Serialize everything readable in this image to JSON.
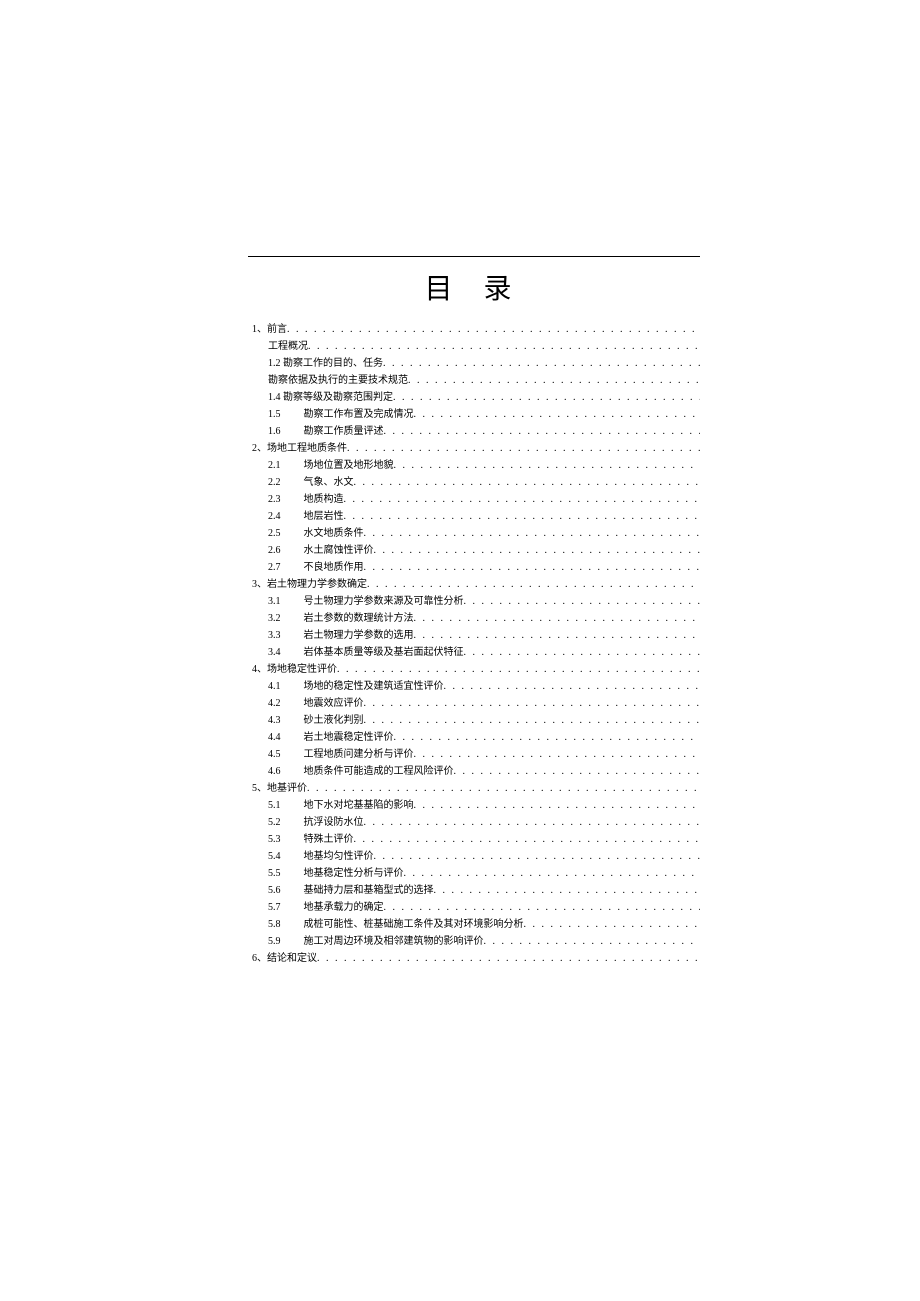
{
  "title": "目 录",
  "toc": [
    {
      "level": 1,
      "num": "1、",
      "text": "前言"
    },
    {
      "level": 2,
      "num": "",
      "text": "工程概况"
    },
    {
      "level": 2,
      "num": "",
      "text": "1.2 勘察工作的目的、任务"
    },
    {
      "level": 2,
      "num": "",
      "text": "勘察依据及执行的主要技术规范"
    },
    {
      "level": 2,
      "num": "",
      "text": "1.4 勘察等级及勘察范围判定"
    },
    {
      "level": 3,
      "num": "1.5",
      "text": "勘察工作布置及完成情况"
    },
    {
      "level": 3,
      "num": "1.6",
      "text": "勘察工作质量评述"
    },
    {
      "level": 1,
      "num": "2、",
      "text": "场地工程地质条件"
    },
    {
      "level": 3,
      "num": "2.1",
      "text": "场地位置及地形地貌"
    },
    {
      "level": 3,
      "num": "2.2",
      "text": "气象、水文"
    },
    {
      "level": 3,
      "num": "2.3",
      "text": "地质构造"
    },
    {
      "level": 3,
      "num": "2.4",
      "text": "地层岩性"
    },
    {
      "level": 3,
      "num": "2.5",
      "text": "水文地质条件"
    },
    {
      "level": 3,
      "num": "2.6",
      "text": "水土腐蚀性评价"
    },
    {
      "level": 3,
      "num": "2.7",
      "text": "不良地质作用"
    },
    {
      "level": 1,
      "num": "3、",
      "text": "岩土物理力学参数确定"
    },
    {
      "level": 3,
      "num": "3.1",
      "text": "号土物理力学参数来源及可靠性分析"
    },
    {
      "level": 3,
      "num": "3.2",
      "text": "岩土参数的数理统计方法"
    },
    {
      "level": 3,
      "num": "3.3",
      "text": "岩土物理力学参数的选用"
    },
    {
      "level": 3,
      "num": "3.4",
      "text": "岩体基本质量等级及基岩面起伏特征"
    },
    {
      "level": 1,
      "num": "4、",
      "text": "场地稳定性评价"
    },
    {
      "level": 3,
      "num": "4.1",
      "text": "场地的稳定性及建筑适宜性评价"
    },
    {
      "level": 3,
      "num": "4.2",
      "text": "地震效应评价"
    },
    {
      "level": 3,
      "num": "4.3",
      "text": "砂土液化判别"
    },
    {
      "level": 3,
      "num": "4.4",
      "text": "岩土地震稳定性评价"
    },
    {
      "level": 3,
      "num": "4.5",
      "text": "工程地质问建分析与评价"
    },
    {
      "level": 3,
      "num": "4.6",
      "text": "地质条件可能造成的工程风险评价"
    },
    {
      "level": 1,
      "num": "5、",
      "text": "地基评价"
    },
    {
      "level": 3,
      "num": "5.1",
      "text": "地下水对坨基基陷的影响"
    },
    {
      "level": 3,
      "num": "5.2",
      "text": "抗浮设防水位"
    },
    {
      "level": 3,
      "num": "5.3",
      "text": "特殊土评价"
    },
    {
      "level": 3,
      "num": "5.4",
      "text": "地基均匀性评价"
    },
    {
      "level": 3,
      "num": "5.5",
      "text": "地基稳定性分析与评价"
    },
    {
      "level": 3,
      "num": "5.6",
      "text": "基础持力层和基箱型式的选择"
    },
    {
      "level": 3,
      "num": "5.7",
      "text": "地基承载力的确定"
    },
    {
      "level": 3,
      "num": "5.8",
      "text": "成桩可能性、桩基础施工条件及其对环境影响分析"
    },
    {
      "level": 3,
      "num": "5.9",
      "text": "施工对周边环境及相邻建筑物的影响评价"
    },
    {
      "level": 1,
      "num": "6、",
      "text": "结论和定议"
    }
  ]
}
